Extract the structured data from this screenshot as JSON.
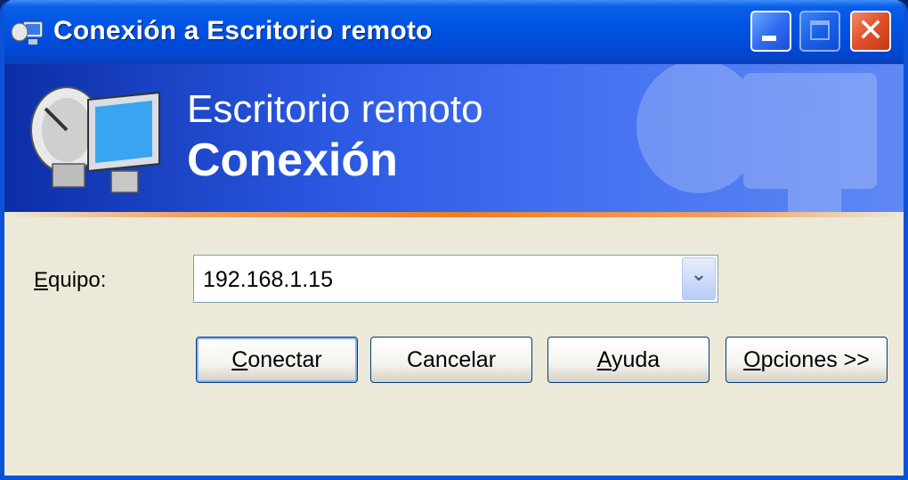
{
  "window": {
    "title": "Conexión a Escritorio remoto"
  },
  "banner": {
    "line1": "Escritorio remoto",
    "line2": "Conexión"
  },
  "form": {
    "equipo_label_first": "E",
    "equipo_label_rest": "quipo:",
    "equipo_value": "192.168.1.15"
  },
  "buttons": {
    "connect": {
      "hotkey": "C",
      "rest": "onectar"
    },
    "cancel": {
      "label": "Cancelar"
    },
    "help": {
      "hotkey": "A",
      "rest": "yuda"
    },
    "options": {
      "hotkey": "O",
      "rest": "pciones >>"
    }
  },
  "icons": {
    "title": "remote-desktop-icon",
    "banner_logo": "satellite-monitor-icon",
    "minimize": "minimize-icon",
    "maximize": "maximize-icon",
    "close": "close-icon",
    "dropdown": "chevron-down-icon"
  },
  "colors": {
    "titlebar": "#0054e3",
    "close": "#e0502a",
    "banner": "#3f6ef0",
    "accent_line": "#e87f2a"
  }
}
